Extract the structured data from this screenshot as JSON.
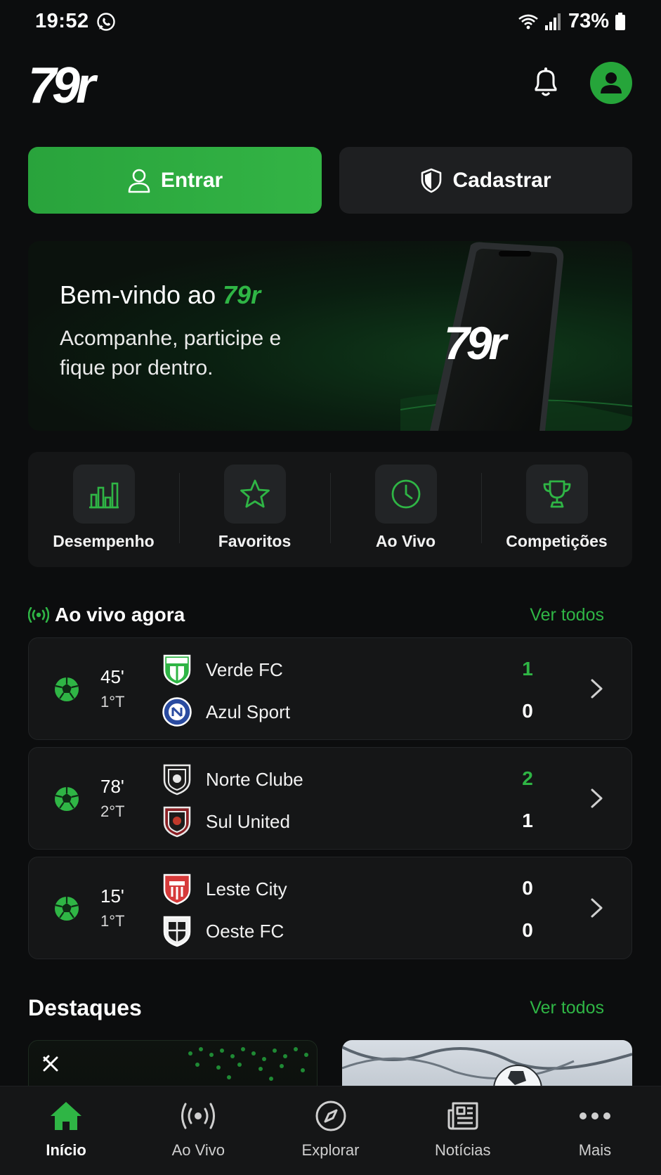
{
  "status_bar": {
    "time": "19:52",
    "battery": "73%"
  },
  "header": {
    "logo_text": "79r"
  },
  "auth": {
    "enter_label": "Entrar",
    "register_label": "Cadastrar"
  },
  "banner": {
    "title_prefix": "Bem-vindo ao",
    "title_brand": "79r",
    "subtitle": "Acompanhe, participe e fique por dentro.",
    "phone_logo": "79r"
  },
  "quick_links": [
    {
      "label": "Desempenho",
      "icon": "bar-chart-icon"
    },
    {
      "label": "Favoritos",
      "icon": "star-icon"
    },
    {
      "label": "Ao Vivo",
      "icon": "clock-icon"
    },
    {
      "label": "Competições",
      "icon": "trophy-icon"
    }
  ],
  "live": {
    "title": "Ao vivo agora",
    "see_all": "Ver todos",
    "matches": [
      {
        "minute": "45'",
        "half": "1°T",
        "home": "Verde FC",
        "away": "Azul Sport",
        "home_score": "1",
        "away_score": "0"
      },
      {
        "minute": "78'",
        "half": "2°T",
        "home": "Norte Clube",
        "away": "Sul United",
        "home_score": "2",
        "away_score": "1"
      },
      {
        "minute": "15'",
        "half": "1°T",
        "home": "Leste City",
        "away": "Oeste FC",
        "home_score": "0",
        "away_score": "0"
      }
    ]
  },
  "highlights": {
    "title": "Destaques",
    "see_all": "Ver todos"
  },
  "tabbar": [
    {
      "label": "Início",
      "icon": "home-icon",
      "active": true
    },
    {
      "label": "Ao Vivo",
      "icon": "broadcast-icon",
      "active": false
    },
    {
      "label": "Explorar",
      "icon": "compass-icon",
      "active": false
    },
    {
      "label": "Notícias",
      "icon": "newspaper-icon",
      "active": false
    },
    {
      "label": "Mais",
      "icon": "more-dots-icon",
      "active": false
    }
  ],
  "colors": {
    "accent": "#2fb545",
    "background": "#0c0d0e",
    "card": "#151617"
  }
}
